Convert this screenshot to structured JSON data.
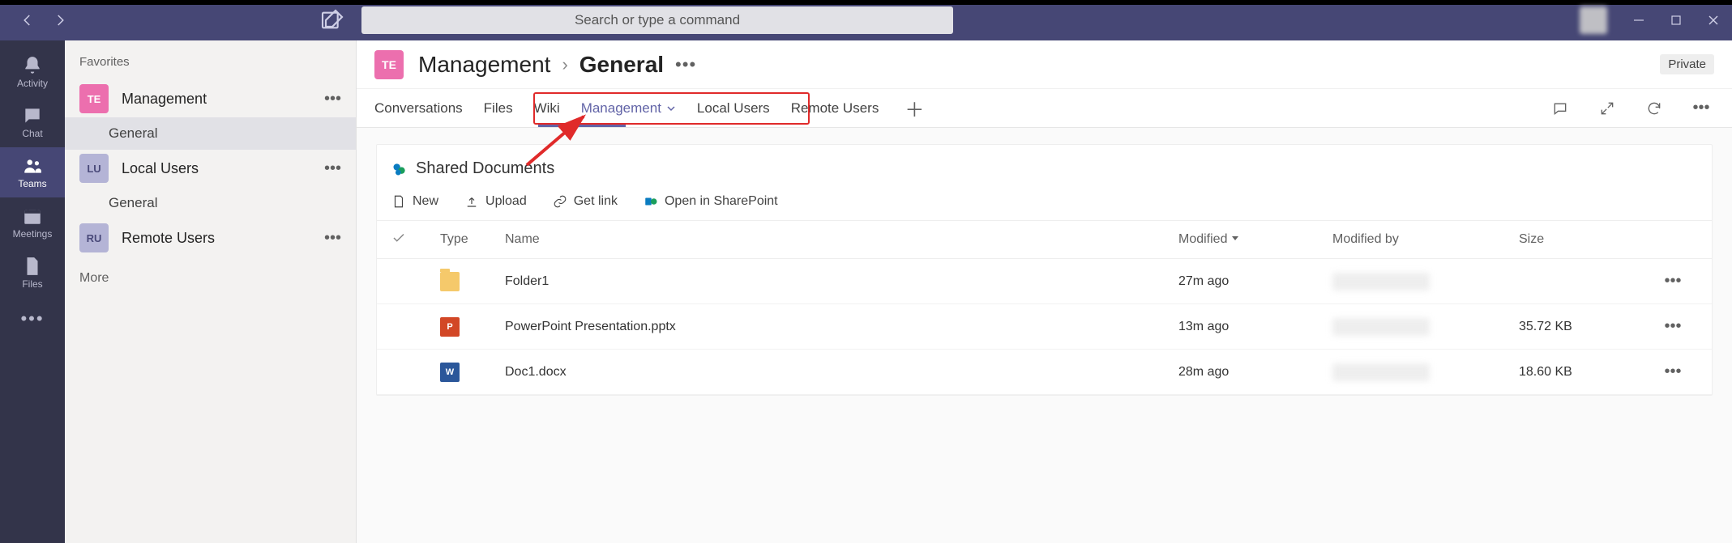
{
  "search": {
    "placeholder": "Search or type a command"
  },
  "rail": {
    "activity": "Activity",
    "chat": "Chat",
    "teams": "Teams",
    "meetings": "Meetings",
    "files": "Files"
  },
  "sidebar": {
    "favorites_label": "Favorites",
    "more_label": "More",
    "teams": [
      {
        "initials": "TE",
        "name": "Management",
        "color": "#ec6fae",
        "channels": [
          "General"
        ],
        "selected_channel": 0
      },
      {
        "initials": "LU",
        "name": "Local Users",
        "color": "#b4b4d6",
        "channels": [
          "General"
        ]
      },
      {
        "initials": "RU",
        "name": "Remote Users",
        "color": "#b4b4d6",
        "channels": []
      }
    ]
  },
  "header": {
    "team_initials": "TE",
    "team_name": "Management",
    "channel_name": "General",
    "privacy": "Private"
  },
  "tabs": {
    "items": [
      "Conversations",
      "Files",
      "Wiki",
      "Management",
      "Local Users",
      "Remote Users"
    ],
    "active_index": 3,
    "callout_range": [
      3,
      5
    ]
  },
  "documents": {
    "title": "Shared Documents",
    "toolbar": {
      "new": "New",
      "upload": "Upload",
      "getlink": "Get link",
      "open_sp": "Open in SharePoint"
    },
    "columns": {
      "type": "Type",
      "name": "Name",
      "modified": "Modified",
      "modified_by": "Modified by",
      "size": "Size"
    },
    "rows": [
      {
        "icon": "folder",
        "name": "Folder1",
        "modified": "27m ago",
        "modified_by": "",
        "size": ""
      },
      {
        "icon": "ppt",
        "name": "PowerPoint Presentation.pptx",
        "modified": "13m ago",
        "modified_by": "",
        "size": "35.72 KB"
      },
      {
        "icon": "doc",
        "name": "Doc1.docx",
        "modified": "28m ago",
        "modified_by": "",
        "size": "18.60 KB"
      }
    ]
  }
}
